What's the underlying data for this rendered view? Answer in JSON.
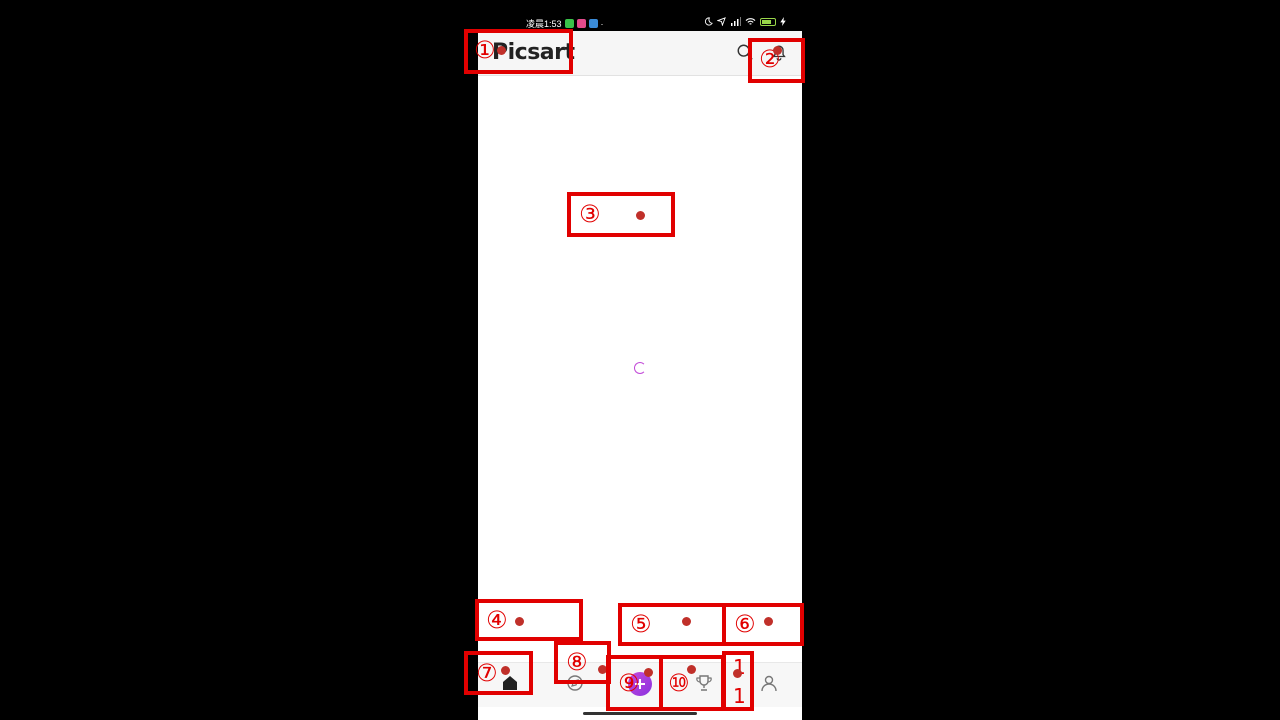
{
  "status_bar": {
    "time": "凌晨1:53",
    "dot": "·"
  },
  "header": {
    "logo": "Picsart",
    "search_icon": "search-icon",
    "notification_icon": "bell-icon"
  },
  "content": {
    "loading_icon": "spinner-icon"
  },
  "bottom_nav": {
    "items": [
      {
        "icon": "home-icon"
      },
      {
        "icon": "discover-icon"
      },
      {
        "icon": "plus-icon"
      },
      {
        "icon": "trophy-icon"
      },
      {
        "icon": "profile-icon"
      }
    ]
  },
  "annotations": {
    "marker_color": "#e10000",
    "labels": [
      "①",
      "②",
      "③",
      "④",
      "⑤",
      "⑥",
      "⑦",
      "⑧",
      "⑨",
      "⑩",
      "1",
      "1"
    ]
  }
}
